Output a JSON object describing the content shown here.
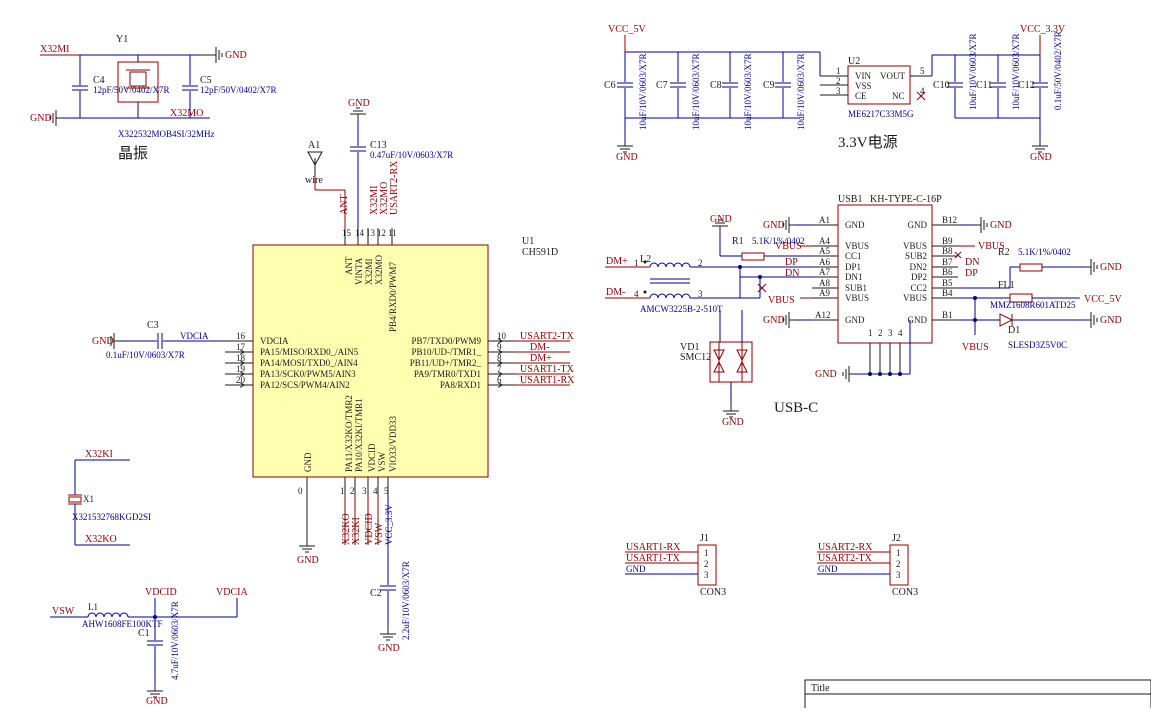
{
  "sheet": {
    "title_label": "Title"
  },
  "labels": {
    "crystal": "晶振",
    "power": "3.3V电源",
    "usbc": "USB-C"
  },
  "power_nets": {
    "gnd": "GND",
    "vcc_5v": "VCC_5V",
    "vcc_3v3_short": "VCC_3.3V",
    "vbus": "VBUS"
  },
  "nets": {
    "x32mi": "X32MI",
    "x32mo": "X32MO",
    "x32ki": "X32KI",
    "x32ko": "X32KO",
    "vdcia": "VDCIA",
    "vdcid": "VDCID",
    "vsw": "VSW",
    "vcc_3v3": "VCC_3.3V",
    "ant": "ANT",
    "usart2_rx": "USART2-RX",
    "usart2_tx": "USART2-TX",
    "usart1_rx": "USART1-RX",
    "usart1_tx": "USART1-TX",
    "dm": "DM-",
    "dp": "DM+",
    "dp_pin": "DP",
    "dn_pin": "DN"
  },
  "y1": {
    "ref": "Y1",
    "part": "X322532MOB4SI/32MHz"
  },
  "c4": {
    "ref": "C4",
    "value": "12pF/50V/0402/X7R"
  },
  "c5": {
    "ref": "C5",
    "value": "12pF/50V/0402/X7R"
  },
  "a1": {
    "ref": "A1",
    "value": "wire"
  },
  "c13": {
    "ref": "C13",
    "value": "0.47uF/10V/0603/X7R"
  },
  "c3": {
    "ref": "C3",
    "value": "0.1uF/10V/0603/X7R"
  },
  "c2": {
    "ref": "C2",
    "value": "2.2uF/10V/0603/X7R"
  },
  "c1": {
    "ref": "C1",
    "value": "4.7uF/10V/0603/X7R"
  },
  "l1": {
    "ref": "L1",
    "value": "AHW1608FE100KTF"
  },
  "x1": {
    "ref": "X1",
    "part": "X321532768KGD2SI"
  },
  "u1": {
    "ref": "U1",
    "part": "CH591D",
    "top_pins": [
      {
        "num": "15",
        "name": "ANT"
      },
      {
        "num": "14",
        "name": "VINTA"
      },
      {
        "num": "13",
        "name": "X32MI"
      },
      {
        "num": "12",
        "name": "X32MO"
      },
      {
        "num": "11",
        "name": "PB4/RXD0/PWM7"
      }
    ],
    "left_pins": [
      {
        "num": "16",
        "name": "VDCIA"
      },
      {
        "num": "17",
        "name": "PA15/MISO/RXD0_/AIN5"
      },
      {
        "num": "18",
        "name": "PA14/MOSI/TXD0_/AIN4"
      },
      {
        "num": "19",
        "name": "PA13/SCK0/PWM5/AIN3"
      },
      {
        "num": "20",
        "name": "PA12/SCS/PWM4/AIN2"
      }
    ],
    "right_pins": [
      {
        "num": "10",
        "name": "PB7/TXD0/PWM9"
      },
      {
        "num": "9",
        "name": "PB10/UD-/TMR1_"
      },
      {
        "num": "8",
        "name": "PB11/UD+/TMR2_"
      },
      {
        "num": "7",
        "name": "PA9/TMR0/TXD1"
      },
      {
        "num": "6",
        "name": "PA8/RXD1"
      }
    ],
    "bottom_pins": [
      {
        "num": "0",
        "name": "GND"
      },
      {
        "num": "1",
        "name": "PA11/X32KO/TMR2"
      },
      {
        "num": "2",
        "name": "PA10/X32KI/TMR1"
      },
      {
        "num": "3",
        "name": "VDCID"
      },
      {
        "num": "4",
        "name": "VSW"
      },
      {
        "num": "5",
        "name": "VIO33/VDD33"
      }
    ]
  },
  "u2": {
    "ref": "U2",
    "part": "ME6217C33M5G",
    "pins": [
      {
        "num": "1",
        "name": "VIN"
      },
      {
        "num": "2",
        "name": "VSS"
      },
      {
        "num": "3",
        "name": "CE"
      },
      {
        "num": "5",
        "name": "VOUT"
      },
      {
        "num": "4",
        "name": "NC"
      }
    ]
  },
  "c6": {
    "ref": "C6",
    "value": "10uF/10V/0603/X7R"
  },
  "c7": {
    "ref": "C7",
    "value": "10uF/10V/0603/X7R"
  },
  "c8": {
    "ref": "C8",
    "value": "10uF/10V/0603/X7R"
  },
  "c9": {
    "ref": "C9",
    "value": "10uF/10V/0603/X7R"
  },
  "c10": {
    "ref": "C10",
    "value": "10uF/10V/0603/X7R"
  },
  "c11": {
    "ref": "C11",
    "value": "10uF/10V/0603/X7R"
  },
  "c12": {
    "ref": "C12",
    "value": "0.1uF/50V/0402/X7R"
  },
  "usb1": {
    "ref": "USB1",
    "part": "KH-TYPE-C-16P",
    "left_pins": [
      {
        "num": "A1",
        "name": "GND"
      },
      {
        "num": "A4",
        "name": "VBUS"
      },
      {
        "num": "A5",
        "name": "CC1"
      },
      {
        "num": "A6",
        "name": "DP1"
      },
      {
        "num": "A7",
        "name": "DN1"
      },
      {
        "num": "A8",
        "name": "SUB1"
      },
      {
        "num": "A9",
        "name": "VBUS"
      },
      {
        "num": "A12",
        "name": "GND"
      }
    ],
    "right_pins": [
      {
        "num": "B12",
        "name": "GND"
      },
      {
        "num": "B9",
        "name": "VBUS"
      },
      {
        "num": "B8",
        "name": "SUB2"
      },
      {
        "num": "B7",
        "name": "DN2"
      },
      {
        "num": "B6",
        "name": "DP2"
      },
      {
        "num": "B5",
        "name": "CC2"
      },
      {
        "num": "B4",
        "name": "VBUS"
      },
      {
        "num": "B1",
        "name": "GND"
      }
    ],
    "bottom_pins": [
      "1",
      "2",
      "3",
      "4"
    ]
  },
  "r1": {
    "ref": "R1",
    "value": "5.1K/1%/0402"
  },
  "r2": {
    "ref": "R2",
    "value": "5.1K/1%/0402"
  },
  "l2": {
    "ref": "L2",
    "part": "AMCW3225B-2-510T",
    "pins": [
      "1",
      "2",
      "4",
      "3"
    ]
  },
  "vd1": {
    "ref": "VD1",
    "part": "SMC12"
  },
  "fl1": {
    "ref": "FL1",
    "part": "MMZ1608R601ATD25"
  },
  "d1": {
    "ref": "D1",
    "part": "SLESD3Z5V0C"
  },
  "j1": {
    "ref": "J1",
    "part": "CON3",
    "pins": [
      "1",
      "2",
      "3"
    ],
    "nets": [
      "USART1-RX",
      "USART1-TX",
      "GND"
    ]
  },
  "j2": {
    "ref": "J2",
    "part": "CON3",
    "pins": [
      "1",
      "2",
      "3"
    ],
    "nets": [
      "USART2-RX",
      "USART2-TX",
      "GND"
    ]
  }
}
